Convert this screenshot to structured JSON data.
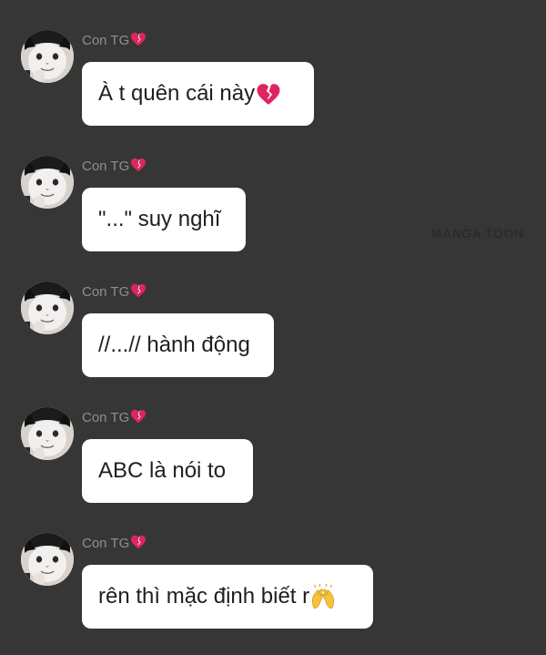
{
  "messages": [
    {
      "sender": "Con TG",
      "text": "À t quên cái này",
      "trailing_icon": "broken-heart"
    },
    {
      "sender": "Con TG",
      "text": "\"...\" suy nghĩ"
    },
    {
      "sender": "Con TG",
      "text": "//...// hành động"
    },
    {
      "sender": "Con TG",
      "text": "ABC là nói to"
    },
    {
      "sender": "Con TG",
      "text": "rên thì mặc định biết r",
      "trailing_icon": "raising-hands"
    }
  ],
  "sender_badge_icon": "broken-heart",
  "watermark": "MANGA TOON",
  "colors": {
    "background": "#363636",
    "bubble": "#ffffff",
    "sender_text": "#8f8f8f",
    "message_text": "#1f1f1f",
    "heart": "#e0245e"
  }
}
